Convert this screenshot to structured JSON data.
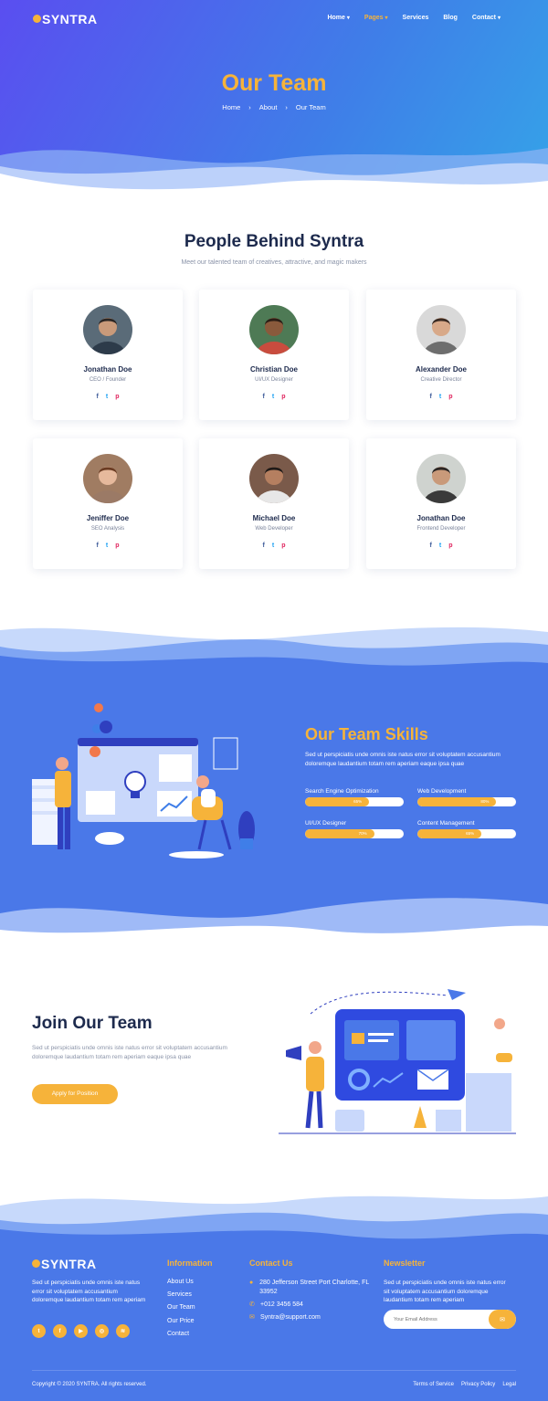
{
  "brand": {
    "name": "SYNTRA",
    "accent": "#f6b33a",
    "primary": "#4a78e8"
  },
  "nav": {
    "items": [
      {
        "label": "Home",
        "caret": "▾"
      },
      {
        "label": "Pages",
        "caret": "▾"
      },
      {
        "label": "Services",
        "caret": ""
      },
      {
        "label": "Blog",
        "caret": ""
      },
      {
        "label": "Contact",
        "caret": "▾"
      }
    ],
    "active": "Pages"
  },
  "hero": {
    "title": "Our Team",
    "breadcrumb": [
      "Home",
      "›",
      "About",
      "›",
      "Our Team"
    ]
  },
  "team": {
    "title": "People Behind Syntra",
    "subtitle": "Meet our talented team of creatives, attractive, and magic makers",
    "members": [
      {
        "name": "Jonathan Doe",
        "role": "CEO / Founder"
      },
      {
        "name": "Christian Doe",
        "role": "UI/UX Designer"
      },
      {
        "name": "Alexander Doe",
        "role": "Creative Director"
      },
      {
        "name": "Jeniffer Doe",
        "role": "SEO Analysis"
      },
      {
        "name": "Michael Doe",
        "role": "Web Developer"
      },
      {
        "name": "Jonathan Doe",
        "role": "Frontend Developer"
      }
    ],
    "social_icons": [
      "facebook-icon",
      "twitter-icon",
      "pinterest-icon"
    ],
    "social_glyphs": {
      "facebook": "f",
      "twitter": "t",
      "pinterest": "p"
    }
  },
  "skills": {
    "title": "Our Team Skills",
    "text": "Sed ut perspiciatis unde omnis iste natus error sit voluptatem accusantium doloremque laudantium totam rem aperiam eaque ipsa quae",
    "items": [
      {
        "label": "Search Engine Optimization",
        "percent": 65,
        "percent_label": "65%"
      },
      {
        "label": "Web Development",
        "percent": 80,
        "percent_label": "80%"
      },
      {
        "label": "UI/UX Designer",
        "percent": 70,
        "percent_label": "70%"
      },
      {
        "label": "Content Management",
        "percent": 65,
        "percent_label": "65%"
      }
    ]
  },
  "join": {
    "title": "Join Our Team",
    "text": "Sed ut perspiciatis unde omnis iste natus error sit voluptatem accusantium doloremque laudantium totam rem aperiam eaque ipsa quae",
    "button": "Apply for Position"
  },
  "footer": {
    "about": "Sed ut perspiciatis unde omnis iste natus error sit voluptatem accusantium doloremque laudantium totam rem aperiam",
    "social_icons": [
      "twitter-icon",
      "facebook-icon",
      "youtube-icon",
      "instagram-icon",
      "rss-icon"
    ],
    "information": {
      "title": "Information",
      "links": [
        "About Us",
        "Services",
        "Our Team",
        "Our Price",
        "Contact"
      ]
    },
    "contact": {
      "title": "Contact Us",
      "address": "280 Jefferson Street Port Charlotte, FL 33952",
      "phone": "+012 3456 584",
      "email": "Syntra@support.com"
    },
    "newsletter": {
      "title": "Newsletter",
      "text": "Sed ut perspiciatis unde omnis iste natus error sit voluptatem accusantium doloremque laudantium totam rem aperiam",
      "placeholder": "Your Email Address"
    },
    "copyright": "Copyright © 2020 SYNTRA. All rights reserved.",
    "legal": [
      "Terms of Service",
      "Privacy Policy",
      "Legal"
    ]
  }
}
